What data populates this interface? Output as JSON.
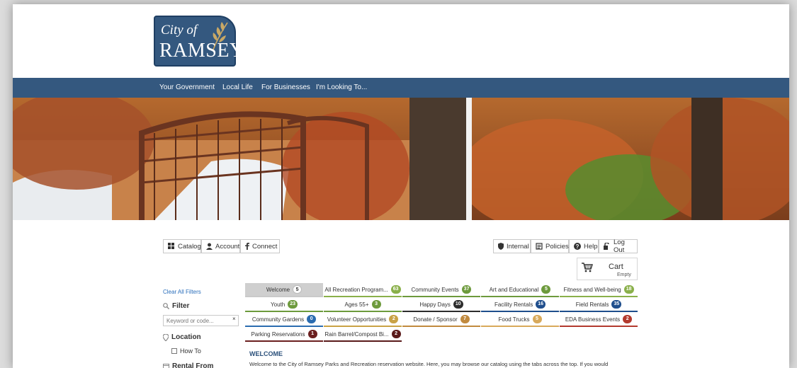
{
  "logo": {
    "line1": "City of",
    "line2": "RAMSEY"
  },
  "nav": [
    "Your Government",
    "Local Life",
    "For Businesses",
    "I'm Looking To..."
  ],
  "toolbar_left": [
    {
      "label": "Catalog",
      "icon": "grid-icon"
    },
    {
      "label": "Account",
      "icon": "user-icon"
    },
    {
      "label": "Connect",
      "icon": "facebook-icon"
    }
  ],
  "toolbar_right": [
    {
      "label": "Internal",
      "icon": "shield-icon"
    },
    {
      "label": "Policies",
      "icon": "document-icon"
    },
    {
      "label": "Help",
      "icon": "question-icon"
    },
    {
      "label": "Log Out",
      "icon": "logout-icon"
    }
  ],
  "cart": {
    "label": "Cart",
    "status": "Empty"
  },
  "sidebar": {
    "clear_filters": "Clear All Filters",
    "filter_heading": "Filter",
    "search_placeholder": "Keyword or code...",
    "clear_icon": "×",
    "location_heading": "Location",
    "location_option": "How To",
    "rental_heading": "Rental From"
  },
  "tabs": [
    {
      "label": "Welcome",
      "count": "5",
      "color": "#ffffff",
      "text_color": "#333333",
      "underline": "#c9c9c9",
      "selected": true
    },
    {
      "label": "All Recreation Program...",
      "count": "63",
      "color": "#8ab04a",
      "text_color": "#ffffff",
      "underline": "#8ab04a"
    },
    {
      "label": "Community Events",
      "count": "37",
      "color": "#6d9a3c",
      "text_color": "#ffffff",
      "underline": "#6d9a3c"
    },
    {
      "label": "Art and Educational",
      "count": "5",
      "color": "#6d9a3c",
      "text_color": "#ffffff",
      "underline": "#6d9a3c"
    },
    {
      "label": "Fitness and Well-being",
      "count": "18",
      "color": "#8ab04a",
      "text_color": "#ffffff",
      "underline": "#8ab04a"
    },
    {
      "label": "Youth",
      "count": "23",
      "color": "#6d9a3c",
      "text_color": "#ffffff",
      "underline": "#6d9a3c"
    },
    {
      "label": "Ages 55+",
      "count": "3",
      "color": "#6d9a3c",
      "text_color": "#ffffff",
      "underline": "#6d9a3c"
    },
    {
      "label": "Happy Days",
      "count": "10",
      "color": "#2d2d2d",
      "text_color": "#ffffff",
      "underline": "#2d2d2d"
    },
    {
      "label": "Facility Rentals",
      "count": "16",
      "color": "#1f4e8c",
      "text_color": "#ffffff",
      "underline": "#1f4e8c"
    },
    {
      "label": "Field Rentals",
      "count": "35",
      "color": "#1f4e8c",
      "text_color": "#ffffff",
      "underline": "#1f4e8c"
    },
    {
      "label": "Community Gardens",
      "count": "0",
      "color": "#2b6cb0",
      "text_color": "#ffffff",
      "underline": "#2b6cb0"
    },
    {
      "label": "Volunteer Opportunities",
      "count": "2",
      "color": "#c9a245",
      "text_color": "#ffffff",
      "underline": "#c9a245"
    },
    {
      "label": "Donate / Sponsor",
      "count": "7",
      "color": "#c18a3e",
      "text_color": "#ffffff",
      "underline": "#c18a3e"
    },
    {
      "label": "Food Trucks",
      "count": "5",
      "color": "#d8a95a",
      "text_color": "#ffffff",
      "underline": "#d8a95a"
    },
    {
      "label": "EDA Business Events",
      "count": "2",
      "color": "#b33a2e",
      "text_color": "#ffffff",
      "underline": "#b33a2e"
    },
    {
      "label": "Parking Reservations",
      "count": "1",
      "color": "#6b1f1f",
      "text_color": "#ffffff",
      "underline": "#6b1f1f"
    },
    {
      "label": "Rain Barrel/Compost Bi...",
      "count": "2",
      "color": "#5a1a1a",
      "text_color": "#ffffff",
      "underline": "#5a1a1a"
    }
  ],
  "welcome": {
    "title": "WELCOME",
    "text": "Welcome to the City of Ramsey Parks and Recreation reservation website. Here, you may browse our catalog using the tabs across the top. If you would"
  }
}
